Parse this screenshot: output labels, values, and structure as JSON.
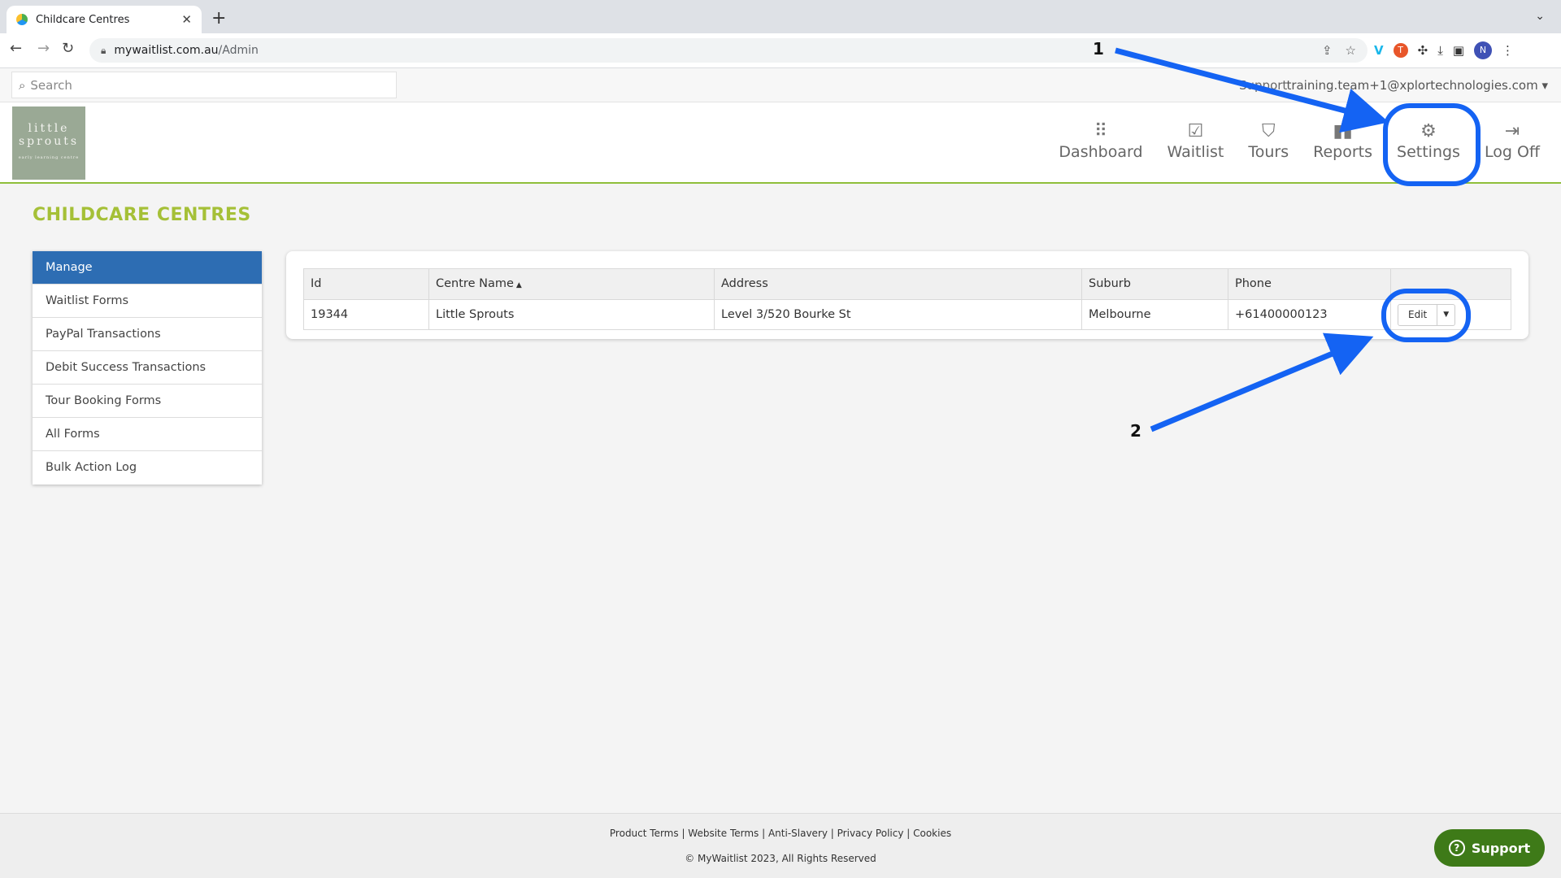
{
  "browser": {
    "tab_title": "Childcare Centres",
    "tab_close": "✕",
    "new_tab": "+",
    "url_host": "mywaitlist.com.au",
    "url_path": "/Admin",
    "avatar_initial": "N"
  },
  "topstrip": {
    "search_placeholder": "Search",
    "support_label": "Support",
    "user_email": "training.team+1@xplortechnologies.com"
  },
  "logo": {
    "line1": "little",
    "line2": "sprouts",
    "tagline": "early learning centre"
  },
  "nav": {
    "items": [
      {
        "label": "Dashboard",
        "icon": "grid-icon"
      },
      {
        "label": "Waitlist",
        "icon": "inbox-check-icon"
      },
      {
        "label": "Tours",
        "icon": "map-icon"
      },
      {
        "label": "Reports",
        "icon": "bar-chart-icon"
      },
      {
        "label": "Settings",
        "icon": "gear-icon"
      },
      {
        "label": "Log Off",
        "icon": "sign-out-icon"
      }
    ]
  },
  "page": {
    "title": "CHILDCARE CENTRES"
  },
  "sidemenu": {
    "items": [
      {
        "label": "Manage"
      },
      {
        "label": "Waitlist Forms"
      },
      {
        "label": "PayPal Transactions"
      },
      {
        "label": "Debit Success Transactions"
      },
      {
        "label": "Tour Booking Forms"
      },
      {
        "label": "All Forms"
      },
      {
        "label": "Bulk Action Log"
      }
    ]
  },
  "table": {
    "headers": [
      "Id",
      "Centre Name",
      "Address",
      "Suburb",
      "Phone",
      ""
    ],
    "sort_indicator": "▲",
    "rows": [
      {
        "id": "19344",
        "name": "Little Sprouts",
        "address": "Level 3/520 Bourke St",
        "suburb": "Melbourne",
        "phone": "+61400000123"
      }
    ],
    "edit_label": "Edit"
  },
  "annotations": {
    "label1": "1",
    "label2": "2",
    "color": "#1463f3"
  },
  "footer": {
    "links": [
      "Product Terms",
      "Website Terms",
      "Anti-Slavery",
      "Privacy Policy",
      "Cookies"
    ],
    "copyright": "© MyWaitlist 2023, All Rights Reserved",
    "support_button": "Support"
  }
}
